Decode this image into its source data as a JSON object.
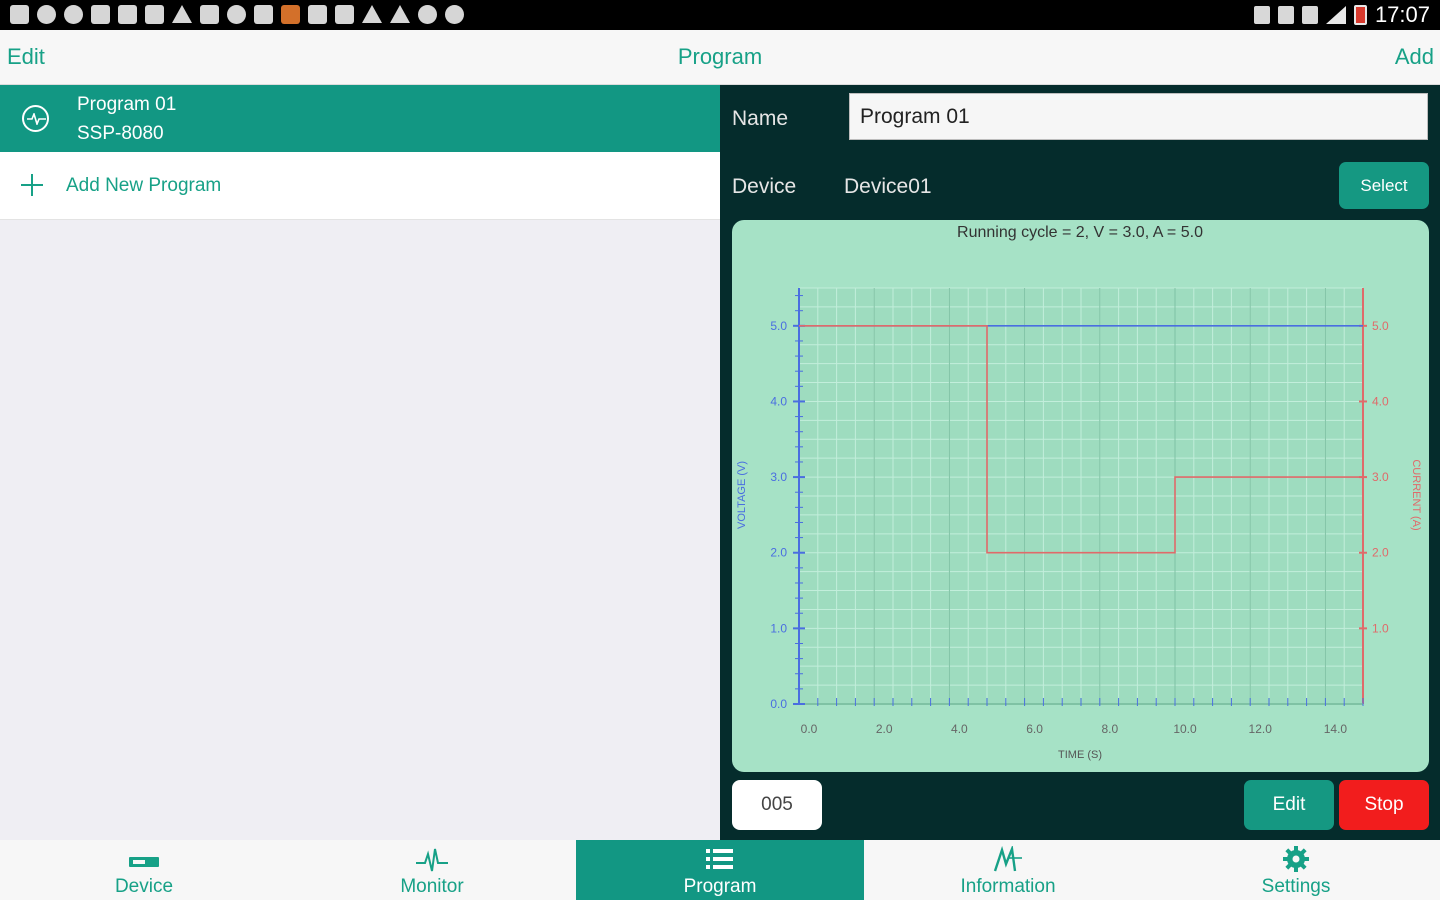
{
  "status_bar": {
    "time": "17:07"
  },
  "top_bar": {
    "edit_label": "Edit",
    "title": "Program",
    "add_label": "Add"
  },
  "program_list": {
    "items": [
      {
        "name": "Program 01",
        "device": "SSP-8080"
      }
    ],
    "add_new_label": "Add New Program"
  },
  "detail": {
    "name_label": "Name",
    "name_value": "Program 01",
    "device_label": "Device",
    "device_value": "Device01",
    "select_label": "Select",
    "cycle_value": "005",
    "edit_label": "Edit",
    "stop_label": "Stop"
  },
  "chart_data": {
    "type": "line",
    "title": "Running cycle = 2, V = 3.0, A = 5.0",
    "xlabel": "TIME (S)",
    "ylabel_left": "VOLTAGE (V)",
    "ylabel_right": "CURRENT (A)",
    "xlim": [
      0,
      15
    ],
    "ylim_left": [
      0,
      5.5
    ],
    "ylim_right": [
      0,
      5.5
    ],
    "x_ticks": [
      "0.0",
      "2.0",
      "4.0",
      "6.0",
      "8.0",
      "10.0",
      "12.0",
      "14.0"
    ],
    "y_ticks_left": [
      "0.0",
      "1.0",
      "2.0",
      "3.0",
      "4.0",
      "5.0"
    ],
    "y_ticks_right": [
      "1.0",
      "2.0",
      "3.0",
      "4.0",
      "5.0"
    ],
    "grid": true,
    "series": [
      {
        "axis": "left",
        "color": "#4a6ee0",
        "x": [
          0,
          15
        ],
        "y": [
          5.0,
          5.0
        ]
      },
      {
        "axis": "right",
        "color": "#e06a6a",
        "x": [
          0,
          5,
          5,
          10,
          10,
          15
        ],
        "y": [
          5.0,
          5.0,
          2.0,
          2.0,
          3.0,
          3.0
        ]
      }
    ]
  },
  "tabs": [
    {
      "label": "Device",
      "icon": "device-icon",
      "active": false
    },
    {
      "label": "Monitor",
      "icon": "monitor-pulse-icon",
      "active": false
    },
    {
      "label": "Program",
      "icon": "list-icon",
      "active": true
    },
    {
      "label": "Information",
      "icon": "information-icon",
      "active": false
    },
    {
      "label": "Settings",
      "icon": "gear-icon",
      "active": false
    }
  ],
  "colors": {
    "accent": "#129783",
    "panel_bg": "#052c2c",
    "chart_bg": "#a6e2c6",
    "stop": "#f21d1d"
  }
}
